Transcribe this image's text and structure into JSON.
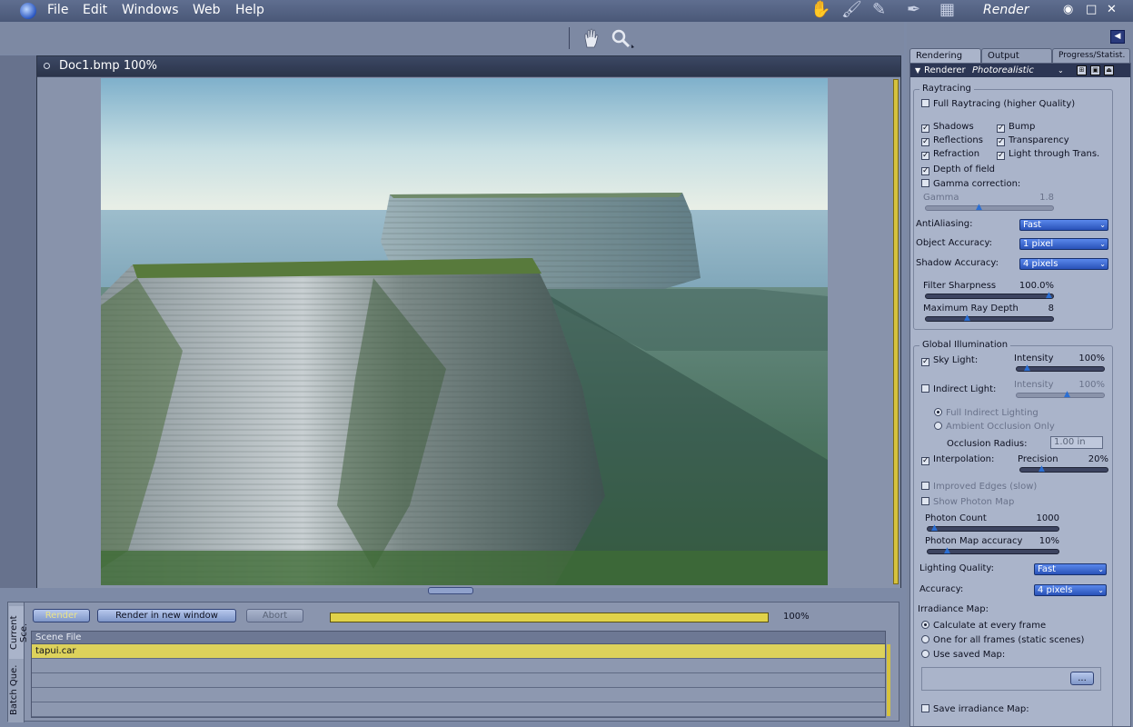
{
  "menu": {
    "items": [
      "File",
      "Edit",
      "Windows",
      "Web",
      "Help"
    ]
  },
  "rooms": {
    "icons": [
      "hand-icon",
      "brush-icon",
      "pencil-icon",
      "pen-icon",
      "film-icon"
    ],
    "title": "Render"
  },
  "window_controls": {
    "eye": "◉",
    "maximize": "□",
    "close": "✕"
  },
  "toolbar": {
    "tools": [
      "hand-tool-icon",
      "magnify-tool-icon"
    ]
  },
  "document": {
    "title": "Doc1.bmp 100%"
  },
  "render_bar": {
    "render_label": "Render",
    "render_new_label": "Render in new window",
    "abort_label": "Abort",
    "progress": 100,
    "progress_text": "100%"
  },
  "bottom_tabs": [
    "Current Sce.",
    "Batch Que."
  ],
  "scene_table": {
    "header": "Scene File",
    "rows": [
      "tapui.car",
      "",
      "",
      "",
      "",
      ""
    ]
  },
  "panel": {
    "tabs": [
      "Rendering",
      "Output",
      "Progress/Statist."
    ],
    "renderer_label": "Renderer",
    "renderer_value": "Photorealistic",
    "raytracing": {
      "title": "Raytracing",
      "full_raytracing": "Full Raytracing (higher Quality)",
      "shadows": "Shadows",
      "bump": "Bump",
      "reflections": "Reflections",
      "transparency": "Transparency",
      "refraction": "Refraction",
      "light_through": "Light through Trans.",
      "dof": "Depth of field",
      "gamma_correction": "Gamma correction:",
      "gamma_label": "Gamma",
      "gamma_value": "1.8",
      "antialiasing_label": "AntiAliasing:",
      "antialiasing_value": "Fast",
      "object_acc_label": "Object Accuracy:",
      "object_acc_value": "1 pixel",
      "shadow_acc_label": "Shadow Accuracy:",
      "shadow_acc_value": "4 pixels",
      "filter_label": "Filter Sharpness",
      "filter_value": "100.0%",
      "ray_depth_label": "Maximum Ray Depth",
      "ray_depth_value": "8"
    },
    "gi": {
      "title": "Global Illumination",
      "sky_light": "Sky Light:",
      "sky_int_label": "Intensity",
      "sky_int_value": "100%",
      "indirect": "Indirect Light:",
      "ind_int_label": "Intensity",
      "ind_int_value": "100%",
      "full_indirect": "Full Indirect Lighting",
      "ambient_occ": "Ambient Occlusion Only",
      "occ_radius_label": "Occlusion Radius:",
      "occ_radius_value": "1.00 in",
      "interpolation": "Interpolation:",
      "precision_label": "Precision",
      "precision_value": "20%",
      "improved_edges": "Improved Edges (slow)",
      "show_photon": "Show Photon Map",
      "photon_count_label": "Photon Count",
      "photon_count_value": "1000",
      "photon_acc_label": "Photon Map accuracy",
      "photon_acc_value": "10%",
      "lighting_quality_label": "Lighting Quality:",
      "lighting_quality_value": "Fast",
      "accuracy_label": "Accuracy:",
      "accuracy_value": "4 pixels",
      "irradiance_label": "Irradiance Map:",
      "calc_every": "Calculate at every frame",
      "one_for_all": "One for all frames (static scenes)",
      "use_saved": "Use saved Map:",
      "browse": "...",
      "save_irr": "Save irradiance Map:"
    }
  }
}
